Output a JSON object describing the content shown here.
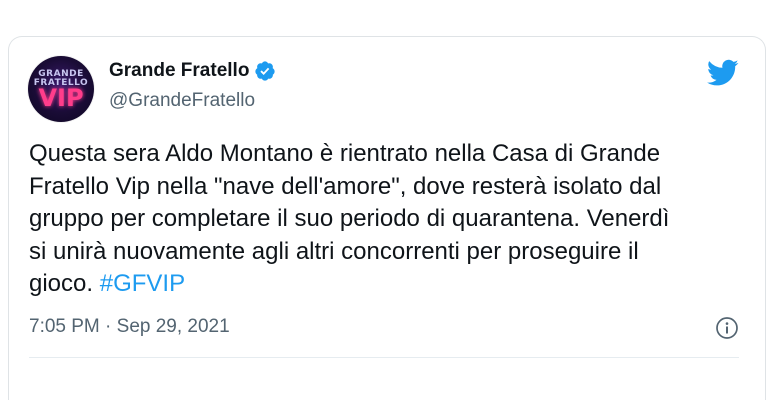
{
  "tweet": {
    "author": {
      "name": "Grande Fratello",
      "handle": "@GrandeFratello",
      "verified": true,
      "avatar": {
        "logo_text_top": "GRANDE FRATELLO",
        "logo_text_bottom": "VIP"
      }
    },
    "text_lines": [
      "Questa sera Aldo Montano è rientrato nella Casa di Grande",
      "Fratello Vip nella \"nave dell'amore\", dove resterà isolato dal",
      "gruppo per completare il suo periodo di quarantena. Venerdì",
      "si unirà nuovamente agli altri concorrenti per proseguire il"
    ],
    "last_line_text": "gioco.",
    "hashtag": "#GFVIP",
    "timestamp": "7:05 PM · Sep 29, 2021",
    "icons": {
      "verified": "verified-badge-icon",
      "platform": "twitter-bird-icon",
      "info": "info-icon"
    },
    "colors": {
      "accent": "#1d9bf0",
      "text": "#0f1419",
      "secondary_text": "#536471",
      "border": "#dfe3e6"
    }
  }
}
